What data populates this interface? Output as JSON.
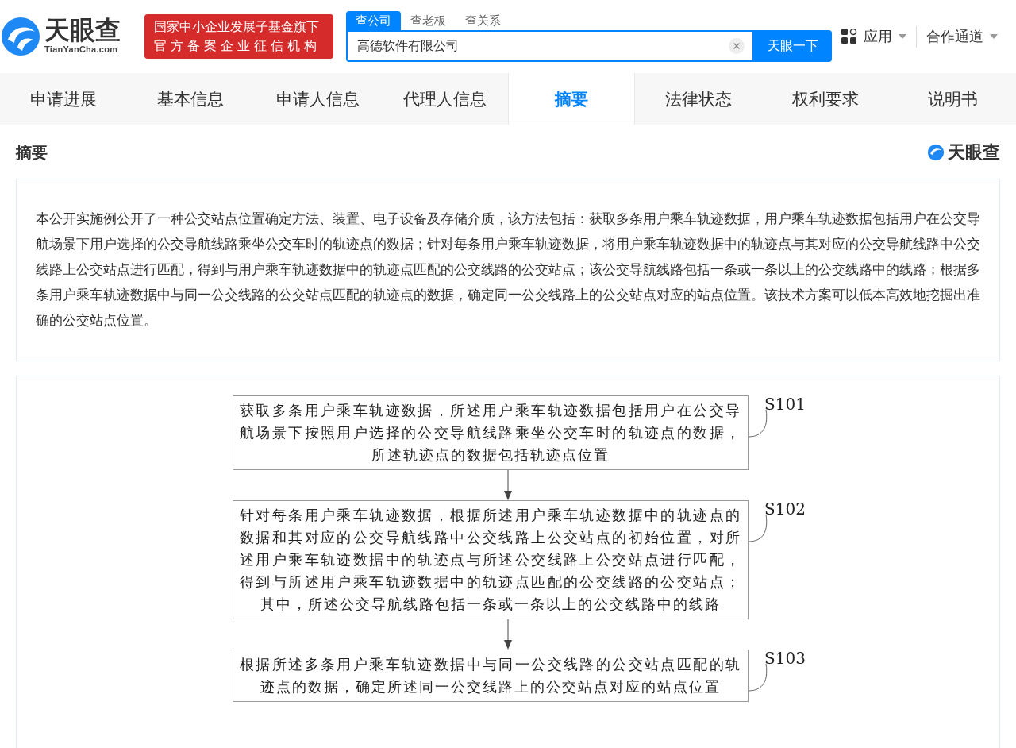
{
  "header": {
    "logo_text": "天眼查",
    "logo_domain": "TianYanCha.com",
    "badge_lines": [
      "国家中小企业发展子基金旗下",
      "官方备案企业征信机构"
    ],
    "search_tabs": [
      {
        "label": "查公司",
        "selected": true
      },
      {
        "label": "查老板",
        "selected": false
      },
      {
        "label": "查关系",
        "selected": false
      }
    ],
    "search": {
      "value": "高德软件有限公司",
      "button": "天眼一下"
    },
    "menus": [
      "应用",
      "合作通道"
    ]
  },
  "tabs": [
    {
      "label": "申请进展",
      "selected": false
    },
    {
      "label": "基本信息",
      "selected": false
    },
    {
      "label": "申请人信息",
      "selected": false
    },
    {
      "label": "代理人信息",
      "selected": false
    },
    {
      "label": "摘要",
      "selected": true
    },
    {
      "label": "法律状态",
      "selected": false
    },
    {
      "label": "权利要求",
      "selected": false
    },
    {
      "label": "说明书",
      "selected": false
    }
  ],
  "section": {
    "title": "摘要",
    "brand": "天眼查"
  },
  "abstract": "本公开实施例公开了一种公交站点位置确定方法、装置、电子设备及存储介质，该方法包括：获取多条用户乘车轨迹数据，用户乘车轨迹数据包括用户在公交导航场景下用户选择的公交导航线路乘坐公交车时的轨迹点的数据；针对每条用户乘车轨迹数据，将用户乘车轨迹数据中的轨迹点与其对应的公交导航线路中公交线路上公交站点进行匹配，得到与用户乘车轨迹数据中的轨迹点匹配的公交线路的公交站点；该公交导航线路包括一条或一条以上的公交线路中的线路；根据多条用户乘车轨迹数据中与同一公交线路的公交站点匹配的轨迹点的数据，确定同一公交线路上的公交站点对应的站点位置。该技术方案可以低本高效地挖掘出准确的公交站点位置。",
  "flowchart": {
    "steps": [
      {
        "label": "S101",
        "text": "获取多条用户乘车轨迹数据，所述用户乘车轨迹数据包括用户在公交导航场景下按照用户选择的公交导航线路乘坐公交车时的轨迹点的数据，所述轨迹点的数据包括轨迹点位置"
      },
      {
        "label": "S102",
        "text": "针对每条用户乘车轨迹数据，根据所述用户乘车轨迹数据中的轨迹点的数据和其对应的公交导航线路中公交线路上公交站点的初始位置，对所述用户乘车轨迹数据中的轨迹点与所述公交线路上公交站点进行匹配，得到与所述用户乘车轨迹数据中的轨迹点匹配的公交线路的公交站点；其中，所述公交导航线路包括一条或一条以上的公交线路中的线路"
      },
      {
        "label": "S103",
        "text": "根据所述多条用户乘车轨迹数据中与同一公交线路的公交站点匹配的轨迹点的数据，确定所述同一公交线路上的公交站点对应的站点位置"
      }
    ]
  }
}
